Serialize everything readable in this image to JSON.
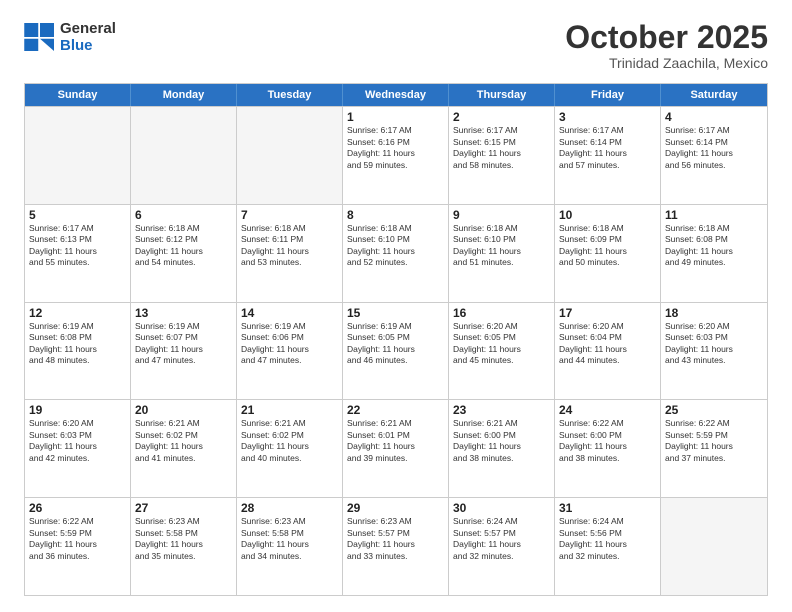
{
  "header": {
    "logo_line1": "General",
    "logo_line2": "Blue",
    "month": "October 2025",
    "location": "Trinidad Zaachila, Mexico"
  },
  "weekdays": [
    "Sunday",
    "Monday",
    "Tuesday",
    "Wednesday",
    "Thursday",
    "Friday",
    "Saturday"
  ],
  "rows": [
    [
      {
        "day": "",
        "info": ""
      },
      {
        "day": "",
        "info": ""
      },
      {
        "day": "",
        "info": ""
      },
      {
        "day": "1",
        "info": "Sunrise: 6:17 AM\nSunset: 6:16 PM\nDaylight: 11 hours\nand 59 minutes."
      },
      {
        "day": "2",
        "info": "Sunrise: 6:17 AM\nSunset: 6:15 PM\nDaylight: 11 hours\nand 58 minutes."
      },
      {
        "day": "3",
        "info": "Sunrise: 6:17 AM\nSunset: 6:14 PM\nDaylight: 11 hours\nand 57 minutes."
      },
      {
        "day": "4",
        "info": "Sunrise: 6:17 AM\nSunset: 6:14 PM\nDaylight: 11 hours\nand 56 minutes."
      }
    ],
    [
      {
        "day": "5",
        "info": "Sunrise: 6:17 AM\nSunset: 6:13 PM\nDaylight: 11 hours\nand 55 minutes."
      },
      {
        "day": "6",
        "info": "Sunrise: 6:18 AM\nSunset: 6:12 PM\nDaylight: 11 hours\nand 54 minutes."
      },
      {
        "day": "7",
        "info": "Sunrise: 6:18 AM\nSunset: 6:11 PM\nDaylight: 11 hours\nand 53 minutes."
      },
      {
        "day": "8",
        "info": "Sunrise: 6:18 AM\nSunset: 6:10 PM\nDaylight: 11 hours\nand 52 minutes."
      },
      {
        "day": "9",
        "info": "Sunrise: 6:18 AM\nSunset: 6:10 PM\nDaylight: 11 hours\nand 51 minutes."
      },
      {
        "day": "10",
        "info": "Sunrise: 6:18 AM\nSunset: 6:09 PM\nDaylight: 11 hours\nand 50 minutes."
      },
      {
        "day": "11",
        "info": "Sunrise: 6:18 AM\nSunset: 6:08 PM\nDaylight: 11 hours\nand 49 minutes."
      }
    ],
    [
      {
        "day": "12",
        "info": "Sunrise: 6:19 AM\nSunset: 6:08 PM\nDaylight: 11 hours\nand 48 minutes."
      },
      {
        "day": "13",
        "info": "Sunrise: 6:19 AM\nSunset: 6:07 PM\nDaylight: 11 hours\nand 47 minutes."
      },
      {
        "day": "14",
        "info": "Sunrise: 6:19 AM\nSunset: 6:06 PM\nDaylight: 11 hours\nand 47 minutes."
      },
      {
        "day": "15",
        "info": "Sunrise: 6:19 AM\nSunset: 6:05 PM\nDaylight: 11 hours\nand 46 minutes."
      },
      {
        "day": "16",
        "info": "Sunrise: 6:20 AM\nSunset: 6:05 PM\nDaylight: 11 hours\nand 45 minutes."
      },
      {
        "day": "17",
        "info": "Sunrise: 6:20 AM\nSunset: 6:04 PM\nDaylight: 11 hours\nand 44 minutes."
      },
      {
        "day": "18",
        "info": "Sunrise: 6:20 AM\nSunset: 6:03 PM\nDaylight: 11 hours\nand 43 minutes."
      }
    ],
    [
      {
        "day": "19",
        "info": "Sunrise: 6:20 AM\nSunset: 6:03 PM\nDaylight: 11 hours\nand 42 minutes."
      },
      {
        "day": "20",
        "info": "Sunrise: 6:21 AM\nSunset: 6:02 PM\nDaylight: 11 hours\nand 41 minutes."
      },
      {
        "day": "21",
        "info": "Sunrise: 6:21 AM\nSunset: 6:02 PM\nDaylight: 11 hours\nand 40 minutes."
      },
      {
        "day": "22",
        "info": "Sunrise: 6:21 AM\nSunset: 6:01 PM\nDaylight: 11 hours\nand 39 minutes."
      },
      {
        "day": "23",
        "info": "Sunrise: 6:21 AM\nSunset: 6:00 PM\nDaylight: 11 hours\nand 38 minutes."
      },
      {
        "day": "24",
        "info": "Sunrise: 6:22 AM\nSunset: 6:00 PM\nDaylight: 11 hours\nand 38 minutes."
      },
      {
        "day": "25",
        "info": "Sunrise: 6:22 AM\nSunset: 5:59 PM\nDaylight: 11 hours\nand 37 minutes."
      }
    ],
    [
      {
        "day": "26",
        "info": "Sunrise: 6:22 AM\nSunset: 5:59 PM\nDaylight: 11 hours\nand 36 minutes."
      },
      {
        "day": "27",
        "info": "Sunrise: 6:23 AM\nSunset: 5:58 PM\nDaylight: 11 hours\nand 35 minutes."
      },
      {
        "day": "28",
        "info": "Sunrise: 6:23 AM\nSunset: 5:58 PM\nDaylight: 11 hours\nand 34 minutes."
      },
      {
        "day": "29",
        "info": "Sunrise: 6:23 AM\nSunset: 5:57 PM\nDaylight: 11 hours\nand 33 minutes."
      },
      {
        "day": "30",
        "info": "Sunrise: 6:24 AM\nSunset: 5:57 PM\nDaylight: 11 hours\nand 32 minutes."
      },
      {
        "day": "31",
        "info": "Sunrise: 6:24 AM\nSunset: 5:56 PM\nDaylight: 11 hours\nand 32 minutes."
      },
      {
        "day": "",
        "info": ""
      }
    ]
  ]
}
